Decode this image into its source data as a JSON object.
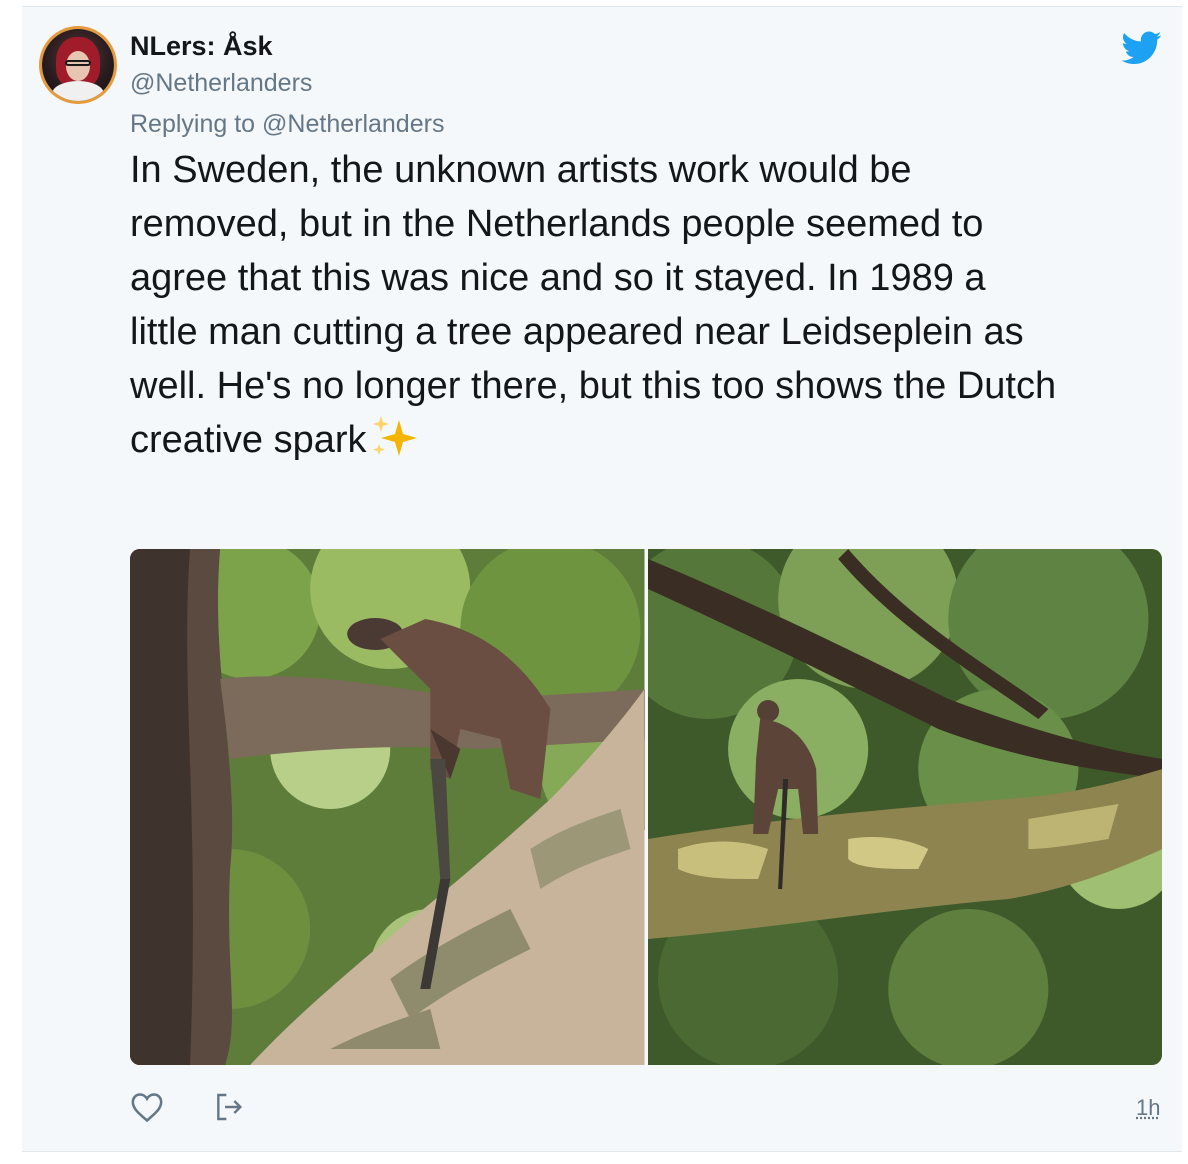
{
  "tweet": {
    "author_name": "NLers: Åsk",
    "author_handle": "@Netherlanders",
    "replying_prefix": "Replying to",
    "replying_to": "@Netherlanders",
    "text": "In Sweden, the unknown artists work would be\nremoved, but in the Netherlands people seemed to\nagree that this was nice and so it stayed. In 1989 a\nlittle man cutting a tree appeared near Leidseplein as\nwell. He's no longer there, but this too shows the Dutch\ncreative spark",
    "emoji": "sparkles",
    "timestamp": "1h"
  },
  "photos": [
    {
      "name": "photo-statue-closeup",
      "subject": "statue-of-man-sawing-branch-closeup"
    },
    {
      "name": "photo-statue-wide",
      "subject": "statue-of-man-sawing-branch-wide"
    }
  ],
  "icons": {
    "brand": "twitter-bird-icon",
    "like": "heart-icon",
    "share": "share-icon"
  },
  "colors": {
    "background": "#f5f8fa",
    "text": "#14171a",
    "secondary_text": "#657786",
    "brand_blue": "#1da1f2",
    "sparkle_gold": "#f4b400"
  }
}
